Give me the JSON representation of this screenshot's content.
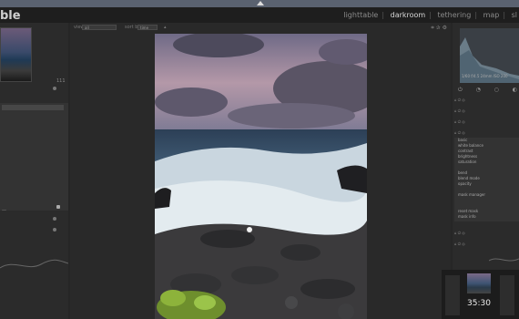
{
  "app": {
    "title": "ble"
  },
  "header": {
    "views": [
      "lighttable",
      "darkroom",
      "tethering",
      "map",
      "sl"
    ],
    "active_view": "darkroom"
  },
  "left_panel": {
    "rows": [
      {
        "text": "111"
      },
      {
        "text": "—"
      }
    ]
  },
  "toolbar": {
    "view_label": "view",
    "view_value": "all",
    "sort_label": "sort by",
    "sort_value": "time"
  },
  "histogram": {
    "info": "1/60 f/4.5 24mm ISO 200"
  },
  "right_panel": {
    "module_list": [
      "basic",
      "white balance",
      "contrast",
      "brightness",
      "saturation",
      "",
      "bend",
      "blend mode",
      "opacity",
      "",
      "mask manager",
      "",
      "",
      "reset mask",
      "mask info"
    ]
  },
  "filmstrip": {
    "timestamp": "35:30"
  },
  "colors": {
    "accent": "#d8d8d8",
    "background": "#262626"
  }
}
